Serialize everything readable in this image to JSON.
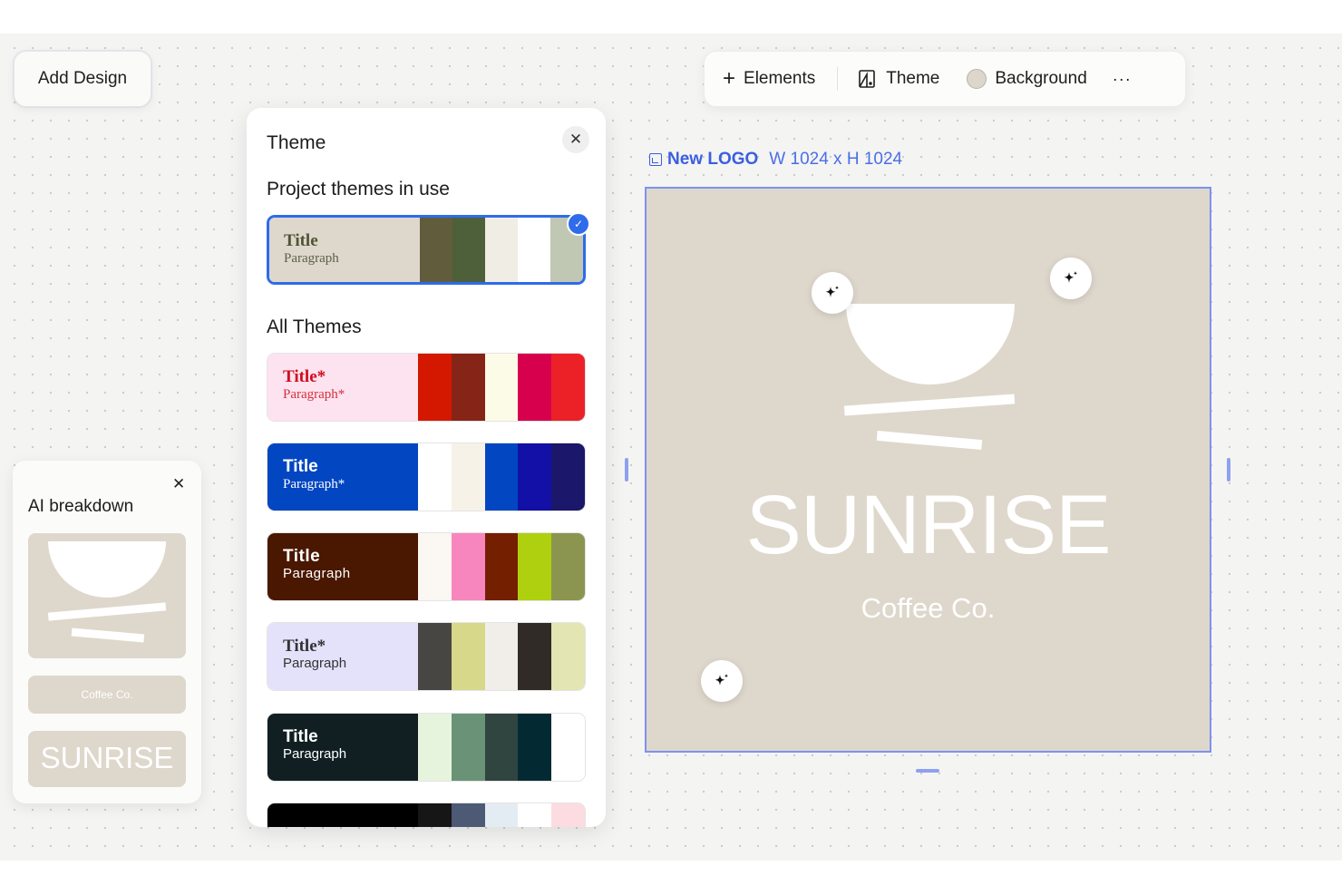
{
  "toolbar_left": {
    "add_design": "Add Design"
  },
  "toolbar": {
    "elements": "Elements",
    "theme": "Theme",
    "background": "Background",
    "more": "···",
    "background_swatch": "#ddd6cb"
  },
  "theme_panel": {
    "title": "Theme",
    "close": "✕",
    "in_use_label": "Project themes in use",
    "all_label": "All Themes",
    "in_use": {
      "title": "Title",
      "paragraph": "Paragraph",
      "bg": "#ded7cc",
      "text_color": "#4f5336",
      "swatches": [
        "#615c3c",
        "#4e6039",
        "#f0ede4",
        "#ffffff",
        "#c0c7b3"
      ]
    },
    "themes": [
      {
        "title": "Title*",
        "paragraph": "Paragraph*",
        "bg": "#fde3ef",
        "title_color": "#d10b1f",
        "para_color": "#d6303e",
        "serif": true,
        "swatches": [
          "#d41800",
          "#862418",
          "#fcfbe8",
          "#d6004c",
          "#ec2128"
        ]
      },
      {
        "title": "Title",
        "paragraph": "Paragraph*",
        "bg": "#0246c2",
        "title_color": "#ffffff",
        "para_color": "#ffffff",
        "serif": false,
        "para_serif": true,
        "swatches": [
          "#ffffff",
          "#f7f2e8",
          "#0246c2",
          "#1210a7",
          "#1b176b"
        ]
      },
      {
        "title": "Title",
        "paragraph": "Paragraph",
        "bg": "#4a1700",
        "title_color": "#ffffff",
        "para_color": "#ffffff",
        "serif": false,
        "swatches": [
          "#fbf7f2",
          "#f886be",
          "#731f00",
          "#afd00e",
          "#8b9550"
        ]
      },
      {
        "title": "Title*",
        "paragraph": "Paragraph",
        "bg": "#e4e2fb",
        "title_color": "#333333",
        "para_color": "#333333",
        "serif": true,
        "para_serif": false,
        "swatches": [
          "#484642",
          "#d7d88a",
          "#f1eeea",
          "#302b26",
          "#e3e5b2"
        ]
      },
      {
        "title": "Title",
        "paragraph": "Paragraph",
        "bg": "#111f23",
        "title_color": "#ffffff",
        "para_color": "#ffffff",
        "serif": false,
        "swatches": [
          "#e7f4dd",
          "#6a9276",
          "#304440",
          "#032a32",
          "#ffffff"
        ]
      },
      {
        "title": "",
        "paragraph": "",
        "bg": "#000000",
        "title_color": "#333333",
        "para_color": "#333333",
        "serif": false,
        "swatches": [
          "#161616",
          "#4c5a75",
          "#e4ecf3",
          "#ffffff",
          "#fcdce0"
        ]
      }
    ]
  },
  "ai_breakdown": {
    "title": "AI breakdown",
    "close": "✕",
    "coffee_text": "Coffee Co.",
    "sunrise_text": "SUNRISE"
  },
  "logo": {
    "name": "New LOGO",
    "dims": "W 1024 x H 1024",
    "brand": "SUNRISE",
    "tagline": "Coffee Co.",
    "bg": "#ded7cc"
  }
}
